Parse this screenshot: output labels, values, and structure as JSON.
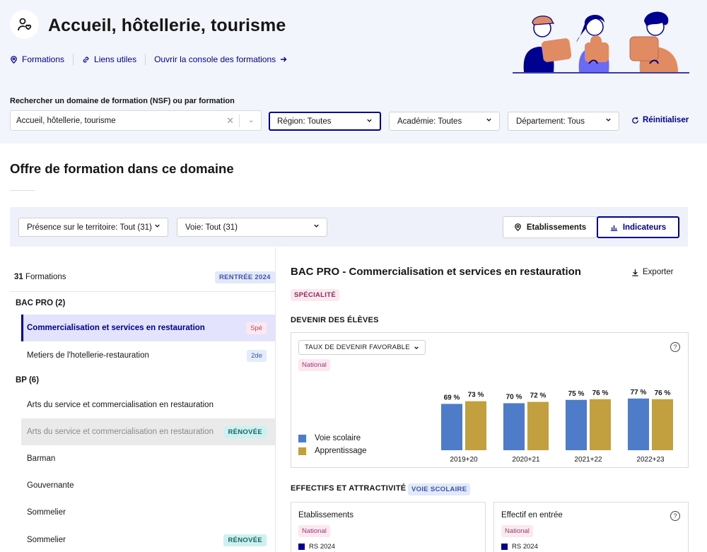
{
  "header": {
    "title": "Accueil, hôtellerie, tourisme",
    "nav": {
      "formations": "Formations",
      "liens": "Liens utiles",
      "console": "Ouvrir la console des formations"
    }
  },
  "search": {
    "label": "Rechercher un domaine de formation (NSF) ou par formation",
    "value": "Accueil, hôtellerie, tourisme"
  },
  "filters": {
    "region": "Région: Toutes",
    "academie": "Académie: Toutes",
    "departement": "Département: Tous",
    "reset": "Réinitialiser"
  },
  "section": {
    "title": "Offre de formation dans ce domaine"
  },
  "filter_bar": {
    "presence": "Présence sur le territoire: Tout (31)",
    "voie": "Voie: Tout (31)",
    "etablissements": "Etablissements",
    "indicateurs": "Indicateurs"
  },
  "list": {
    "count": "31",
    "count_label": "Formations",
    "rentree": "RENTRÉE 2024",
    "groups": [
      {
        "title": "BAC PRO (2)"
      },
      {
        "title": "BP (6)"
      }
    ],
    "items": [
      {
        "label": "Commercialisation et services en restauration",
        "tag": "Spé"
      },
      {
        "label": "Metiers de l'hotellerie-restauration",
        "tag": "2de"
      },
      {
        "label": "Arts du service et commercialisation en restauration",
        "tag": ""
      },
      {
        "label": "Arts du service et commercialisation en restauration",
        "tag": "RÉNOVÉE"
      },
      {
        "label": "Barman",
        "tag": ""
      },
      {
        "label": "Gouvernante",
        "tag": ""
      },
      {
        "label": "Sommelier",
        "tag": ""
      },
      {
        "label": "Sommelier",
        "tag": "RÉNOVÉE"
      }
    ]
  },
  "detail": {
    "title": "BAC PRO - Commercialisation et services en restauration",
    "export": "Exporter",
    "badge": "SPÉCIALITÉ",
    "devenir_title": "DEVENIR DES ÉLÈVES",
    "indicator": "TAUX DE DEVENIR FAVORABLE",
    "scope": "National",
    "effectifs_title": "EFFECTIFS ET ATTRACTIVITÉ",
    "voie_badge": "VOIE SCOLAIRE",
    "cards": [
      {
        "title": "Etablissements",
        "scope": "National",
        "series": "RS 2024"
      },
      {
        "title": "Effectif en entrée",
        "scope": "National",
        "series": "RS 2024"
      }
    ]
  },
  "colors": {
    "accent": "#000091",
    "voie_scolaire": "#4f7cc9",
    "apprentissage": "#c2a040"
  },
  "chart_data": {
    "type": "bar",
    "categories": [
      "2019+20",
      "2020+21",
      "2021+22",
      "2022+23"
    ],
    "series": [
      {
        "name": "Voie scolaire",
        "values": [
          69,
          70,
          75,
          77
        ],
        "labels": [
          "69 %",
          "70 %",
          "75 %",
          "77 %"
        ]
      },
      {
        "name": "Apprentissage",
        "values": [
          73,
          72,
          76,
          76
        ],
        "labels": [
          "73 %",
          "72 %",
          "76 %",
          "76 %"
        ]
      }
    ],
    "unit": "%"
  }
}
